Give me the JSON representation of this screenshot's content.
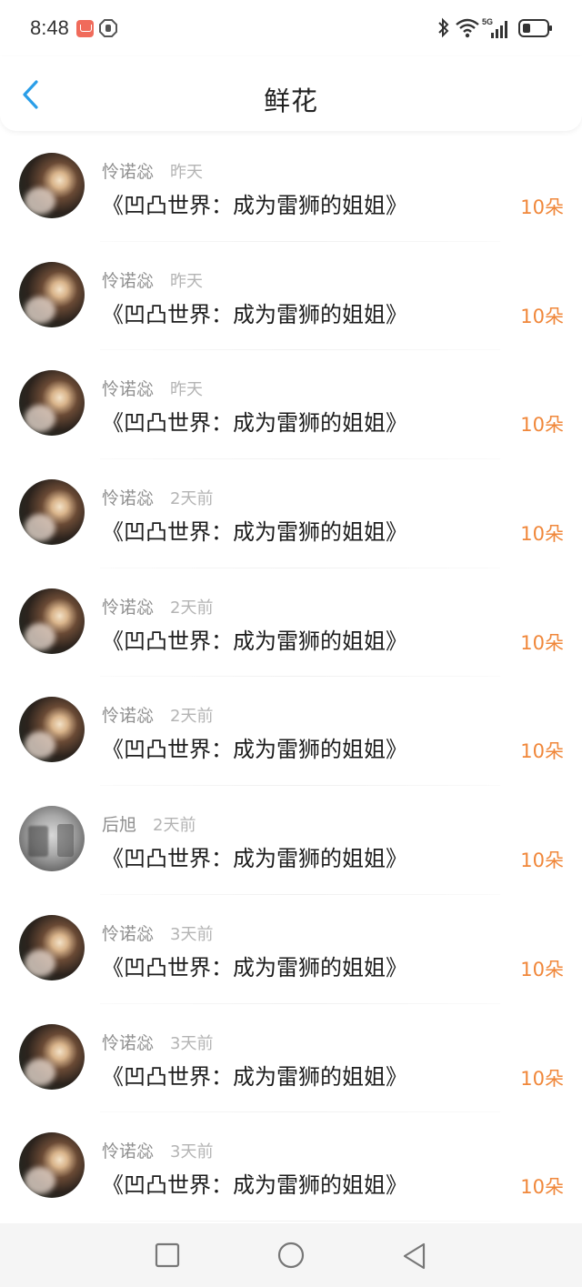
{
  "status_bar": {
    "time": "8:48",
    "icons": [
      "notification-app-icon",
      "shield-app-icon",
      "bluetooth-icon",
      "wifi-icon",
      "5g-signal-icon",
      "battery-icon"
    ],
    "network": "5G"
  },
  "header": {
    "title": "鲜花",
    "back_icon": "chevron-left-icon"
  },
  "colors": {
    "accent_back": "#2a9ee8",
    "flower_count": "#f0873a",
    "meta_text": "#8f8f8f"
  },
  "items": [
    {
      "user": "怜诺惢",
      "time": "昨天",
      "book": "《凹凸世界：成为雷狮的姐姐》",
      "count": "10朵",
      "avatar": "portrait"
    },
    {
      "user": "怜诺惢",
      "time": "昨天",
      "book": "《凹凸世界：成为雷狮的姐姐》",
      "count": "10朵",
      "avatar": "portrait"
    },
    {
      "user": "怜诺惢",
      "time": "昨天",
      "book": "《凹凸世界：成为雷狮的姐姐》",
      "count": "10朵",
      "avatar": "portrait"
    },
    {
      "user": "怜诺惢",
      "time": "2天前",
      "book": "《凹凸世界：成为雷狮的姐姐》",
      "count": "10朵",
      "avatar": "portrait"
    },
    {
      "user": "怜诺惢",
      "time": "2天前",
      "book": "《凹凸世界：成为雷狮的姐姐》",
      "count": "10朵",
      "avatar": "portrait"
    },
    {
      "user": "怜诺惢",
      "time": "2天前",
      "book": "《凹凸世界：成为雷狮的姐姐》",
      "count": "10朵",
      "avatar": "portrait"
    },
    {
      "user": "后旭",
      "time": "2天前",
      "book": "《凹凸世界：成为雷狮的姐姐》",
      "count": "10朵",
      "avatar": "gray"
    },
    {
      "user": "怜诺惢",
      "time": "3天前",
      "book": "《凹凸世界：成为雷狮的姐姐》",
      "count": "10朵",
      "avatar": "portrait"
    },
    {
      "user": "怜诺惢",
      "time": "3天前",
      "book": "《凹凸世界：成为雷狮的姐姐》",
      "count": "10朵",
      "avatar": "portrait"
    },
    {
      "user": "怜诺惢",
      "time": "3天前",
      "book": "《凹凸世界：成为雷狮的姐姐》",
      "count": "10朵",
      "avatar": "portrait"
    }
  ],
  "nav_bar": {
    "buttons": [
      "recent-apps-icon",
      "home-icon",
      "back-triangle-icon"
    ]
  }
}
